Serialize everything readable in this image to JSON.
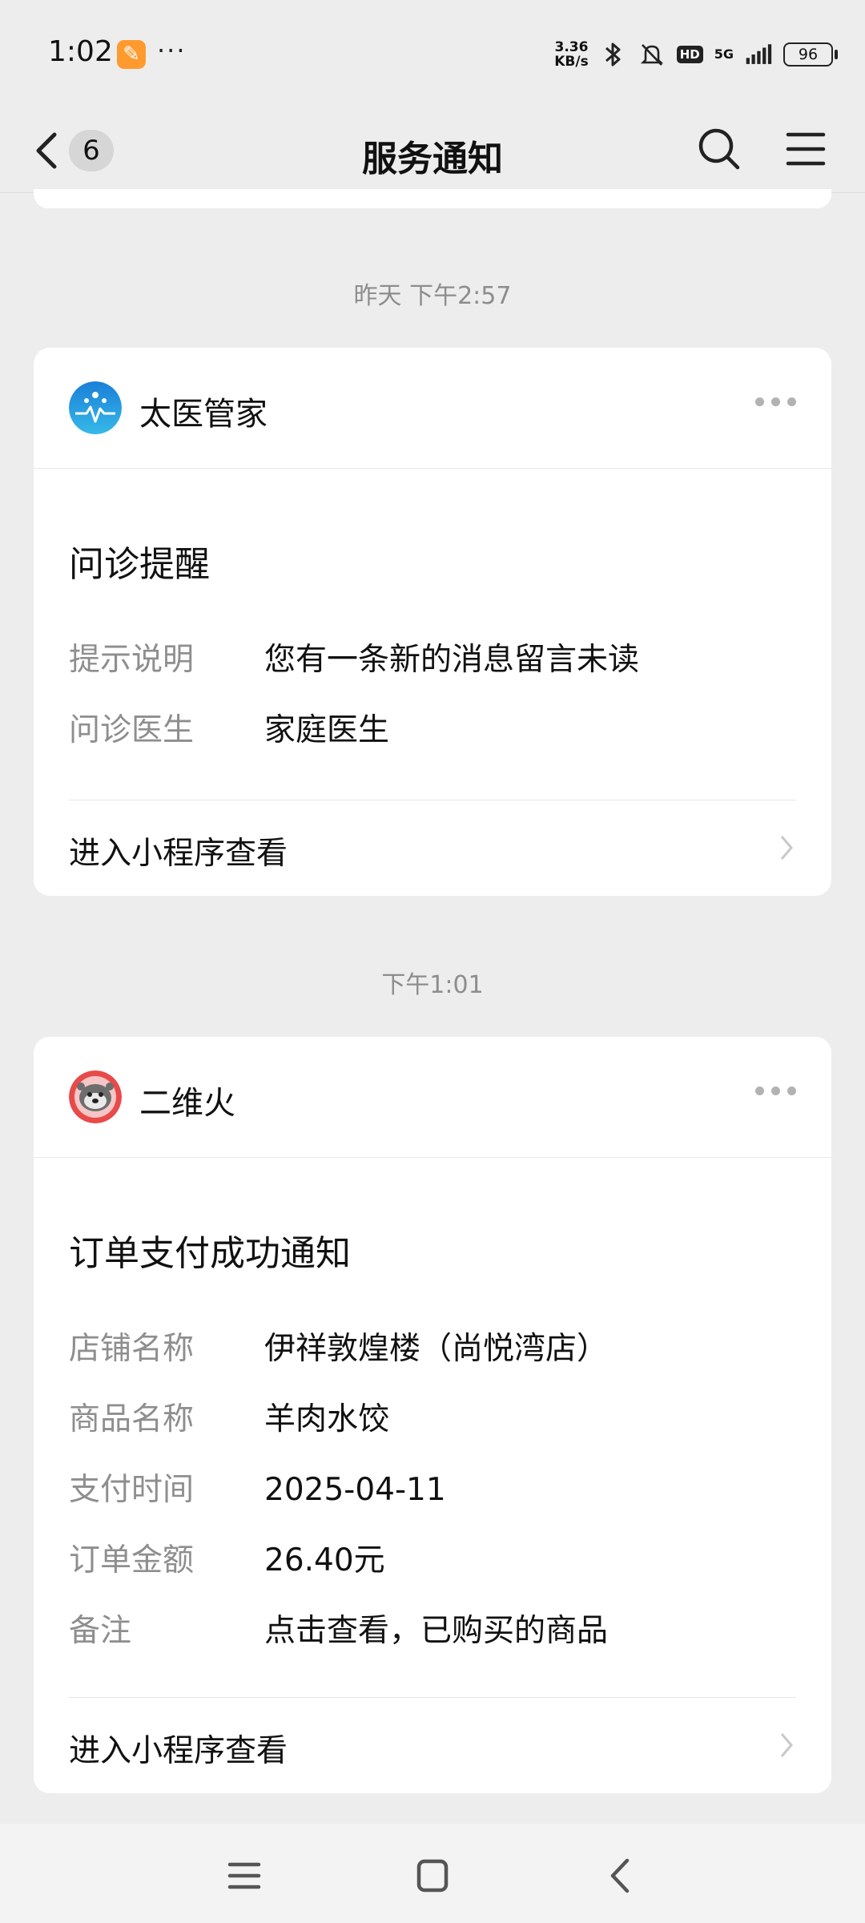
{
  "status": {
    "time": "1:02",
    "net_speed_top": "3.36",
    "net_speed_bottom": "KB/s",
    "network": "5G",
    "hd": "HD",
    "battery": "96"
  },
  "nav": {
    "back_count": "6",
    "title": "服务通知"
  },
  "messages": [
    {
      "timestamp": "昨天 下午2:57",
      "app_name": "太医管家",
      "title": "问诊提醒",
      "fields": [
        {
          "label": "提示说明",
          "value": "您有一条新的消息留言未读"
        },
        {
          "label": "问诊医生",
          "value": "家庭医生"
        }
      ],
      "action": "进入小程序查看"
    },
    {
      "timestamp": "下午1:01",
      "app_name": "二维火",
      "title": "订单支付成功通知",
      "fields": [
        {
          "label": "店铺名称",
          "value": "伊祥敦煌楼（尚悦湾店）"
        },
        {
          "label": "商品名称",
          "value": "羊肉水饺"
        },
        {
          "label": "支付时间",
          "value": "2025-04-11"
        },
        {
          "label": "订单金额",
          "value": "26.40元"
        },
        {
          "label": "备注",
          "value": "点击查看，已购买的商品"
        }
      ],
      "action": "进入小程序查看"
    }
  ],
  "icons": {
    "back": "chevron-left-icon",
    "search": "search-icon",
    "menu": "menu-icon",
    "more": "more-dots-icon",
    "chevron": "chevron-right-icon"
  },
  "colors": {
    "background": "#ededed",
    "card": "#ffffff",
    "label_gray": "#8e8e8e",
    "app_icon_blue": "#1e8fe0",
    "app_icon_red": "#e84a4a"
  }
}
